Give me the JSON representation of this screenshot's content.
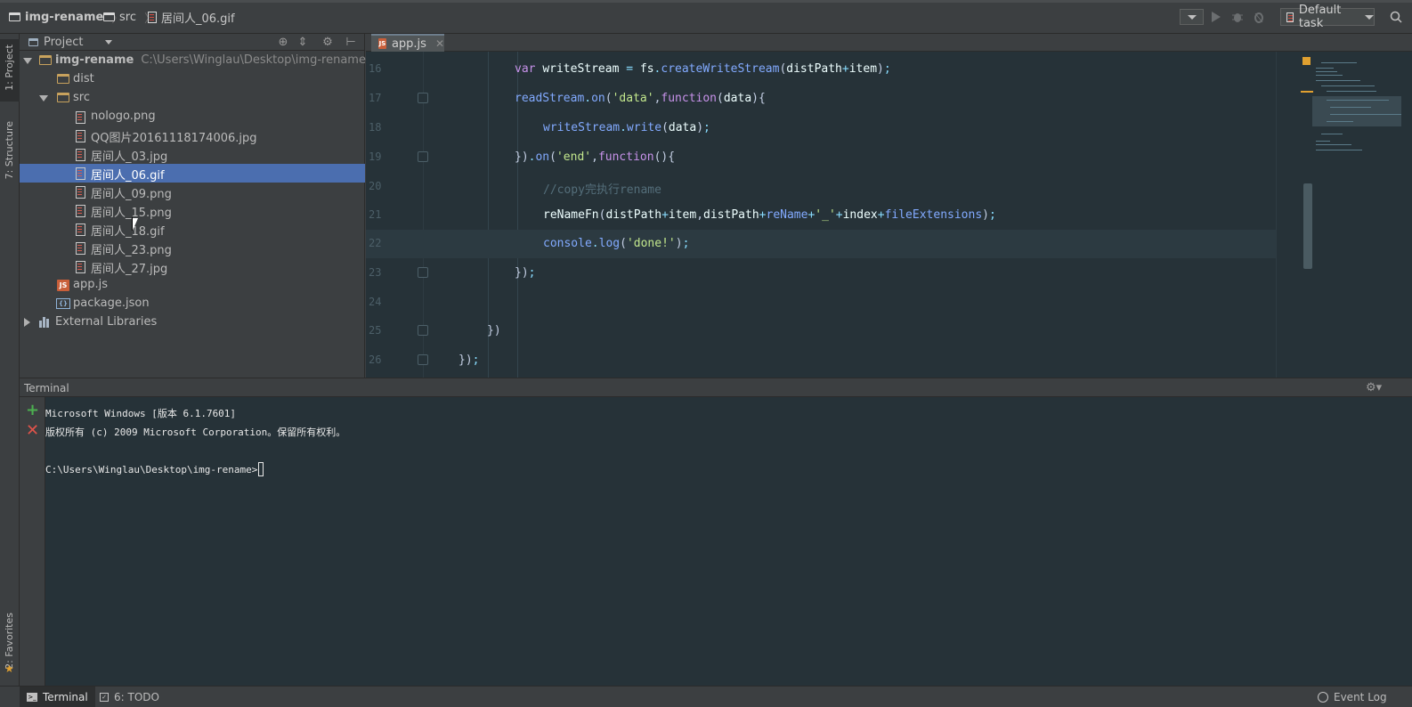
{
  "breadcrumb": {
    "project": "img-rename",
    "folder": "src",
    "file": "居间人_06.gif"
  },
  "toolbar": {
    "task_label": "Default task",
    "run_icon": "play-icon",
    "debug_icon": "bug-icon"
  },
  "left_strip": {
    "project_tab": "1: Project",
    "structure_tab": "7: Structure",
    "favorites_tab": "2: Favorites"
  },
  "project_panel": {
    "selector_label": "Project",
    "root_name": "img-rename",
    "root_path": "C:\\Users\\Winglau\\Desktop\\img-rename",
    "items": [
      {
        "label": "dist",
        "type": "folder"
      },
      {
        "label": "src",
        "type": "folder"
      },
      {
        "label": "nologo.png",
        "type": "image"
      },
      {
        "label": "QQ图片20161118174006.jpg",
        "type": "image"
      },
      {
        "label": "居间人_03.jpg",
        "type": "image"
      },
      {
        "label": "居间人_06.gif",
        "type": "image"
      },
      {
        "label": "居间人_09.png",
        "type": "image"
      },
      {
        "label": "居间人_15.png",
        "type": "image"
      },
      {
        "label": "居间人_18.gif",
        "type": "image"
      },
      {
        "label": "居间人_23.png",
        "type": "image"
      },
      {
        "label": "居间人_27.jpg",
        "type": "image"
      },
      {
        "label": "app.js",
        "type": "js"
      },
      {
        "label": "package.json",
        "type": "json"
      },
      {
        "label": "External Libraries",
        "type": "lib"
      }
    ],
    "selected_item": "居间人_06.gif"
  },
  "editor": {
    "tab_label": "app.js",
    "line_numbers": [
      "16",
      "17",
      "18",
      "19",
      "20",
      "21",
      "22",
      "23",
      "24",
      "25",
      "26"
    ],
    "current_line": "22"
  },
  "terminal": {
    "title": "Terminal",
    "line1": "Microsoft Windows [版本 6.1.7601]",
    "line2": "版权所有 (c) 2009 Microsoft Corporation。保留所有权利。",
    "prompt": "C:\\Users\\Winglau\\Desktop\\img-rename>"
  },
  "bottom_bar": {
    "terminal_tab": "Terminal",
    "todo_tab": "6: TODO",
    "event_log": "Event Log"
  },
  "colors": {
    "selection": "#4b6eaf",
    "editor_bg": "#263238",
    "panel_bg": "#3c3f41"
  }
}
